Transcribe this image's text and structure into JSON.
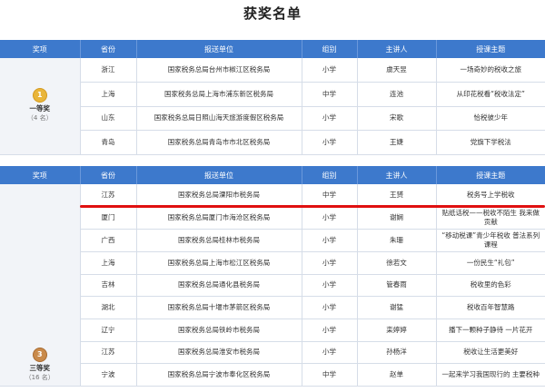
{
  "title": "获奖名单",
  "headers": [
    "奖项",
    "省份",
    "报送单位",
    "组别",
    "主讲人",
    "授课主题"
  ],
  "first_prize": {
    "award_name": "一等奖",
    "award_count": "（4 名）",
    "medal": "gold-medal-1",
    "medal_text": "1",
    "rows": [
      {
        "province": "浙江",
        "unit": "国家税务总局台州市椒江区税务局",
        "group": "小学",
        "speaker": "虞天昱",
        "topic": "一场奇妙的税收之旅"
      },
      {
        "province": "上海",
        "unit": "国家税务总局上海市浦东新区税务局",
        "group": "中学",
        "speaker": "连池",
        "topic": "从印花税看“税收法定”"
      },
      {
        "province": "山东",
        "unit": "国家税务总局日照山海天旅游度假区税务局",
        "group": "小学",
        "speaker": "宋歌",
        "topic": "恰税彼少年"
      },
      {
        "province": "青岛",
        "unit": "国家税务总局青岛市市北区税务局",
        "group": "小学",
        "speaker": "王婕",
        "topic": "党旗下学税法"
      }
    ]
  },
  "third_prize": {
    "award_name": "三等奖",
    "award_count": "（16 名）",
    "medal": "bronze-medal-3",
    "medal_text": "3",
    "rows": [
      {
        "province": "江苏",
        "unit": "国家税务总局溧阳市税务局",
        "group": "中学",
        "speaker": "王赟",
        "topic": "税务号上学税收"
      },
      {
        "province": "厦门",
        "unit": "国家税务总局厦门市海沧区税务局",
        "group": "小学",
        "speaker": "谢娴",
        "topic": "贴纸话税——税收不陌生 我来做贡献"
      },
      {
        "province": "广西",
        "unit": "国家税务总局桂林市税务局",
        "group": "小学",
        "speaker": "朱珊",
        "topic": "“移动税课”青少年税收 普法系列课程"
      },
      {
        "province": "上海",
        "unit": "国家税务总局上海市松江区税务局",
        "group": "小学",
        "speaker": "徐若文",
        "topic": "一份民生“礼包”"
      },
      {
        "province": "吉林",
        "unit": "国家税务总局通化县税务局",
        "group": "小学",
        "speaker": "管春雨",
        "topic": "税收里的色彩"
      },
      {
        "province": "湖北",
        "unit": "国家税务总局十堰市茅箭区税务局",
        "group": "小学",
        "speaker": "谢猛",
        "topic": "税收百年智慧路"
      },
      {
        "province": "辽宁",
        "unit": "国家税务总局铁岭市税务局",
        "group": "小学",
        "speaker": "栾婷婷",
        "topic": "播下一颗种子静待 一片花开"
      },
      {
        "province": "江苏",
        "unit": "国家税务总局淮安市税务局",
        "group": "小学",
        "speaker": "孙杨洋",
        "topic": "税收让生活更美好"
      },
      {
        "province": "宁波",
        "unit": "国家税务总局宁波市奉化区税务局",
        "group": "中学",
        "speaker": "赵单",
        "topic": "一起来学习我国现行的 主要税种"
      }
    ]
  },
  "annotation": {
    "color": "#e01010",
    "target_row": "江苏 国家税务总局溧阳市税务局"
  }
}
